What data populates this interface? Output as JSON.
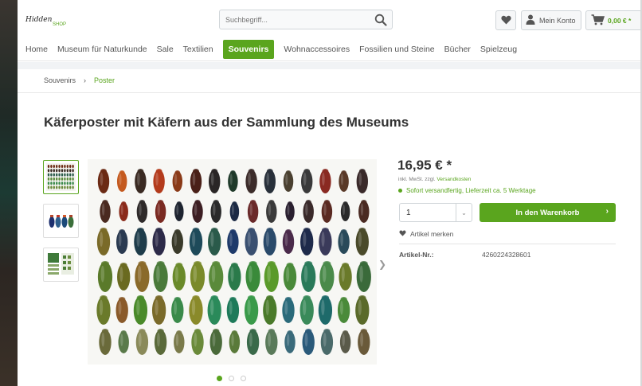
{
  "header": {
    "logo_text": "Hidden",
    "logo_shop": "SHOP",
    "search_placeholder": "Suchbegriff...",
    "account_label": "Mein Konto",
    "cart_amount": "0,00 € *"
  },
  "nav": {
    "items": [
      "Home",
      "Museum für Naturkunde",
      "Sale",
      "Textilien",
      "Souvenirs",
      "Wohnaccessoires",
      "Fossilien und Steine",
      "Bücher",
      "Spielzeug"
    ],
    "active": "Souvenirs"
  },
  "breadcrumb": {
    "items": [
      "Souvenirs",
      "Poster"
    ],
    "separator": "›"
  },
  "product": {
    "title": "Käferposter mit Käfern aus der Sammlung des Museums",
    "price": "16,95 € *",
    "tax_prefix": "inkl. MwSt. zzgl.",
    "tax_link": "Versandkosten",
    "delivery": "Sofort versandfertig, Lieferzeit ca. 5 Werktage",
    "quantity": "1",
    "add_to_cart": "In den Warenkorb",
    "wishlist": "Artikel merken",
    "article_label": "Artikel-Nr.:",
    "article_number": "4260224328601"
  },
  "gallery": {
    "dots": 3,
    "active_dot": 0
  },
  "colors": {
    "accent": "#5aa51e",
    "text": "#333333",
    "muted": "#555555"
  }
}
